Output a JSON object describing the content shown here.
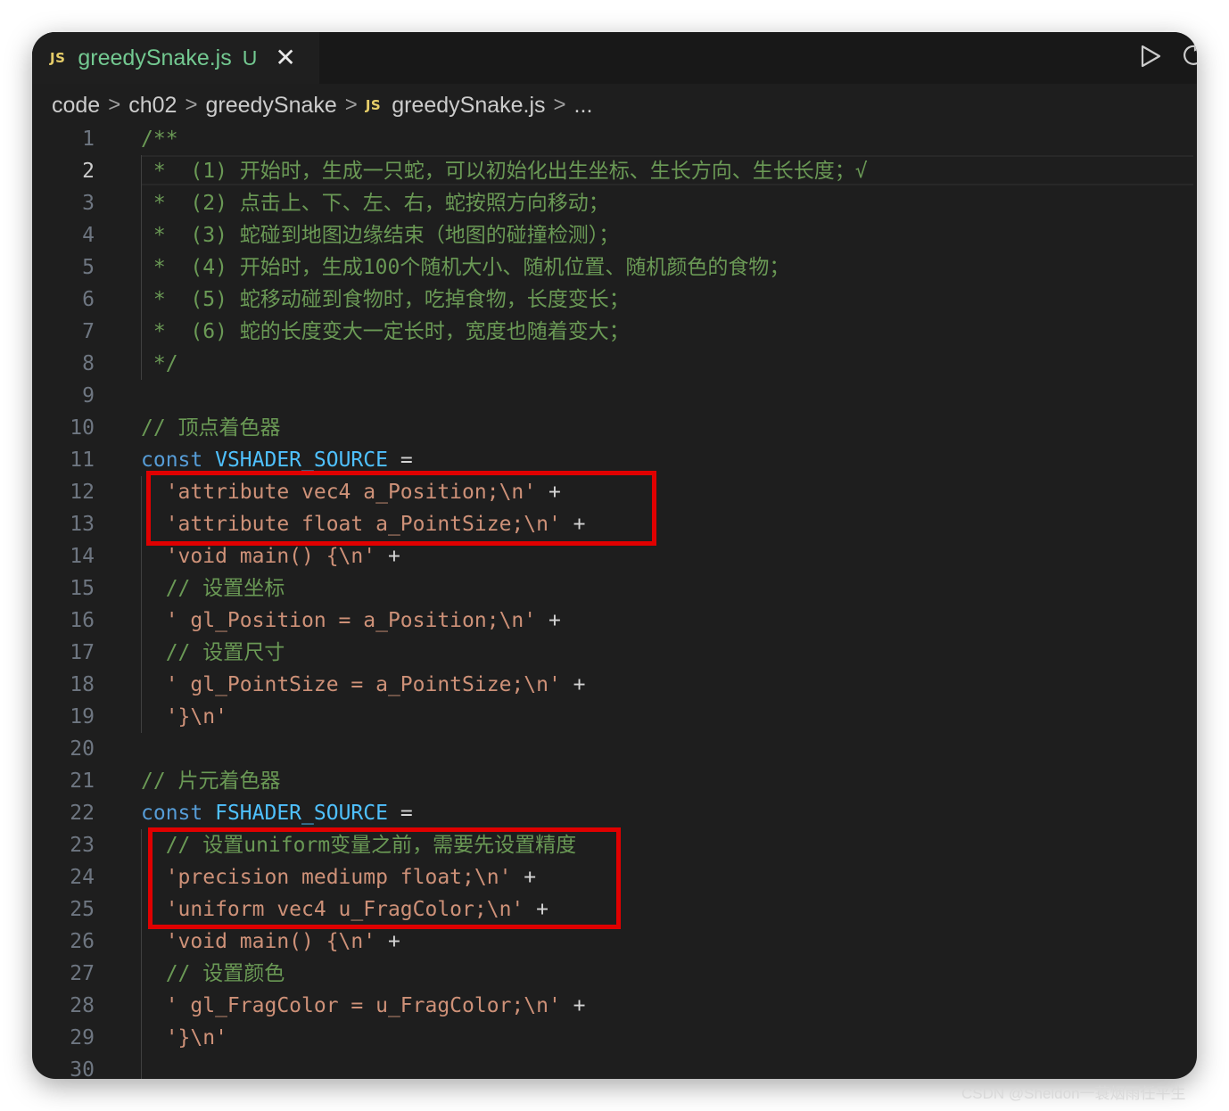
{
  "tab": {
    "badge": "JS",
    "filename": "greedySnake.js",
    "status": "U",
    "close": "✕"
  },
  "toolbar": {
    "run_icon": "play-icon",
    "split_icon": "split-editor-icon"
  },
  "breadcrumb": {
    "items": [
      "code",
      "ch02",
      "greedySnake"
    ],
    "file_badge": "JS",
    "file": "greedySnake.js",
    "ellipsis": "...",
    "separator": ">"
  },
  "editor": {
    "active_line": 2,
    "lines": [
      {
        "n": "1",
        "tokens": [
          {
            "t": "/**",
            "c": "c"
          }
        ]
      },
      {
        "n": "2",
        "tokens": [
          {
            "t": " *  (1) 开始时，生成一只蛇，可以初始化出生坐标、生长方向、生长长度；√",
            "c": "c"
          }
        ]
      },
      {
        "n": "3",
        "tokens": [
          {
            "t": " *  (2) 点击上、下、左、右，蛇按照方向移动；",
            "c": "c"
          }
        ]
      },
      {
        "n": "4",
        "tokens": [
          {
            "t": " *  (3) 蛇碰到地图边缘结束（地图的碰撞检测）；",
            "c": "c"
          }
        ]
      },
      {
        "n": "5",
        "tokens": [
          {
            "t": " *  (4) 开始时，生成100个随机大小、随机位置、随机颜色的食物；",
            "c": "c"
          }
        ]
      },
      {
        "n": "6",
        "tokens": [
          {
            "t": " *  (5) 蛇移动碰到食物时，吃掉食物，长度变长；",
            "c": "c"
          }
        ]
      },
      {
        "n": "7",
        "tokens": [
          {
            "t": " *  (6) 蛇的长度变大一定长时，宽度也随着变大；",
            "c": "c"
          }
        ]
      },
      {
        "n": "8",
        "tokens": [
          {
            "t": " */",
            "c": "c"
          }
        ]
      },
      {
        "n": "9",
        "tokens": []
      },
      {
        "n": "10",
        "tokens": [
          {
            "t": "// 顶点着色器",
            "c": "c"
          }
        ]
      },
      {
        "n": "11",
        "tokens": [
          {
            "t": "const ",
            "c": "k"
          },
          {
            "t": "VSHADER_SOURCE",
            "c": "v"
          },
          {
            "t": " =",
            "c": "o"
          }
        ]
      },
      {
        "n": "12",
        "tokens": [
          {
            "t": "  'attribute vec4 a_Position;\\n'",
            "c": "s"
          },
          {
            "t": " +",
            "c": "o"
          }
        ]
      },
      {
        "n": "13",
        "tokens": [
          {
            "t": "  'attribute float a_PointSize;\\n'",
            "c": "s"
          },
          {
            "t": " +",
            "c": "o"
          }
        ]
      },
      {
        "n": "14",
        "tokens": [
          {
            "t": "  'void main() {\\n'",
            "c": "s"
          },
          {
            "t": " +",
            "c": "o"
          }
        ]
      },
      {
        "n": "15",
        "tokens": [
          {
            "t": "  // 设置坐标",
            "c": "c"
          }
        ]
      },
      {
        "n": "16",
        "tokens": [
          {
            "t": "  ' gl_Position = a_Position;\\n'",
            "c": "s"
          },
          {
            "t": " +",
            "c": "o"
          }
        ]
      },
      {
        "n": "17",
        "tokens": [
          {
            "t": "  // 设置尺寸",
            "c": "c"
          }
        ]
      },
      {
        "n": "18",
        "tokens": [
          {
            "t": "  ' gl_PointSize = a_PointSize;\\n'",
            "c": "s"
          },
          {
            "t": " +",
            "c": "o"
          }
        ]
      },
      {
        "n": "19",
        "tokens": [
          {
            "t": "  '}\\n'",
            "c": "s"
          }
        ]
      },
      {
        "n": "20",
        "tokens": []
      },
      {
        "n": "21",
        "tokens": [
          {
            "t": "// 片元着色器",
            "c": "c"
          }
        ]
      },
      {
        "n": "22",
        "tokens": [
          {
            "t": "const ",
            "c": "k"
          },
          {
            "t": "FSHADER_SOURCE",
            "c": "v"
          },
          {
            "t": " =",
            "c": "o"
          }
        ]
      },
      {
        "n": "23",
        "tokens": [
          {
            "t": "  // 设置uniform变量之前，需要先设置精度",
            "c": "c"
          }
        ]
      },
      {
        "n": "24",
        "tokens": [
          {
            "t": "  'precision mediump float;\\n'",
            "c": "s"
          },
          {
            "t": " +",
            "c": "o"
          }
        ]
      },
      {
        "n": "25",
        "tokens": [
          {
            "t": "  'uniform vec4 u_FragColor;\\n'",
            "c": "s"
          },
          {
            "t": " +",
            "c": "o"
          }
        ]
      },
      {
        "n": "26",
        "tokens": [
          {
            "t": "  'void main() {\\n'",
            "c": "s"
          },
          {
            "t": " +",
            "c": "o"
          }
        ]
      },
      {
        "n": "27",
        "tokens": [
          {
            "t": "  // 设置颜色",
            "c": "c"
          }
        ]
      },
      {
        "n": "28",
        "tokens": [
          {
            "t": "  ' gl_FragColor = u_FragColor;\\n'",
            "c": "s"
          },
          {
            "t": " +",
            "c": "o"
          }
        ]
      },
      {
        "n": "29",
        "tokens": [
          {
            "t": "  '}\\n'",
            "c": "s"
          }
        ]
      },
      {
        "n": "30",
        "tokens": []
      }
    ]
  },
  "annotations": {
    "box_color": "#e00000",
    "boxes": [
      {
        "covers_lines": [
          12,
          13
        ]
      },
      {
        "covers_lines": [
          23,
          25
        ]
      }
    ]
  },
  "watermark": "CSDN @Sheldon一蓑烟雨任平生",
  "colors": {
    "comment": "#6a9955",
    "keyword": "#569cd6",
    "constant": "#4fc1ff",
    "string": "#ce9178",
    "tab_modified": "#73c991",
    "js_badge": "#e6cd69"
  }
}
